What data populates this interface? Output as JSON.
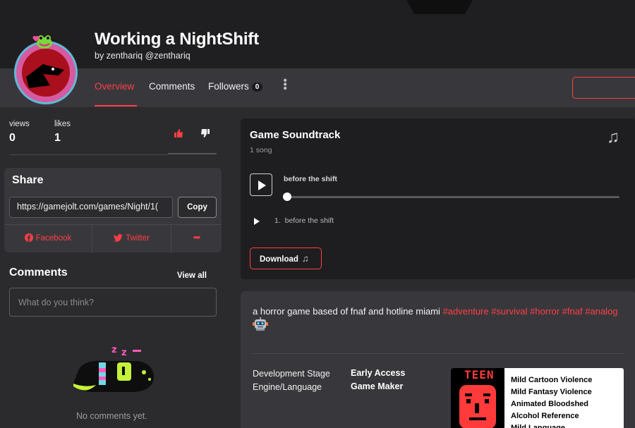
{
  "game": {
    "title": "Working a NightShift",
    "byline": "by zenthariq @zenthariq"
  },
  "tabs": {
    "overview": "Overview",
    "comments": "Comments",
    "followers": "Followers",
    "followers_count": "0"
  },
  "stats": {
    "views_label": "views",
    "views_value": "0",
    "likes_label": "likes",
    "likes_value": "1"
  },
  "share": {
    "title": "Share",
    "url": "https://gamejolt.com/games/Night/1(",
    "copy_label": "Copy",
    "facebook_label": "Facebook",
    "twitter_label": "Twitter",
    "more_label": "•••"
  },
  "comments": {
    "title": "Comments",
    "view_all": "View all",
    "placeholder": "What do you think?",
    "empty_text": "No comments yet."
  },
  "soundtrack": {
    "title": "Game Soundtrack",
    "song_count": "1 song",
    "current_song": "before the shift",
    "progress": 0.0,
    "tracks": [
      {
        "number": "1.",
        "title": "before the shift"
      }
    ],
    "download_label": "Download",
    "download_icon": "music-note-icon"
  },
  "description": {
    "text": "a horror game based of fnaf and hotline miami",
    "hashtags": [
      "#adventure",
      "#survival",
      "#horror",
      "#fnaf",
      "#analog"
    ],
    "emoji": "robot-emoji"
  },
  "details": {
    "dev_stage_label": "Development Stage",
    "dev_stage_value": "Early Access",
    "engine_label": "Engine/Language",
    "engine_value": "Game Maker"
  },
  "rating": {
    "badge": "TEEN",
    "descriptors": [
      "Mild Cartoon Violence",
      "Mild Fantasy Violence",
      "Animated Bloodshed",
      "Alcohol Reference",
      "Mild Language"
    ]
  },
  "colors": {
    "accent": "#ff3e45",
    "background": "#2b2b2e",
    "card": "#38383c",
    "dark_card": "#1e1e20"
  }
}
